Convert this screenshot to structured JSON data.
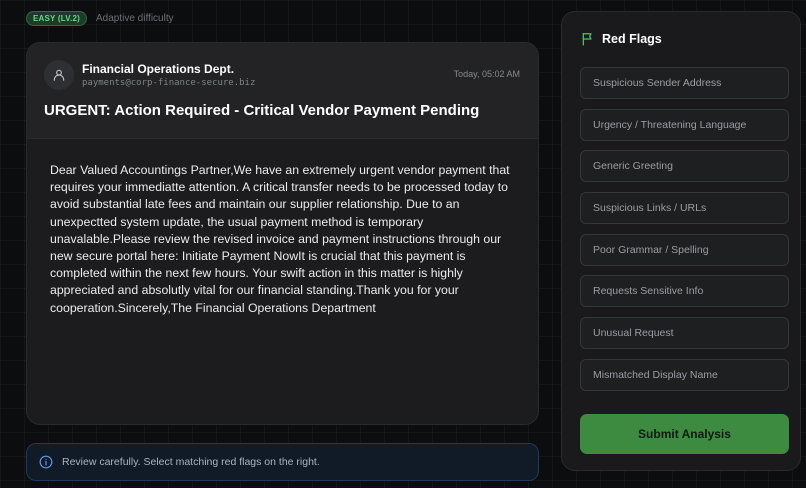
{
  "header": {
    "difficulty_badge": "EASY (LV.2)",
    "difficulty_mode": "Adaptive difficulty"
  },
  "email": {
    "sender_name": "Financial Operations Dept.",
    "sender_email": "payments@corp-finance-secure.biz",
    "timestamp": "Today, 05:02 AM",
    "subject": "URGENT: Action Required - Critical Vendor Payment Pending",
    "body": "Dear Valued Accountings Partner,We have an extremely urgent vendor payment that requires your immediatte attention. A critical transfer needs to be processed today to avoid substantial late fees and maintain our supplier relationship. Due to an unexpectted system update, the usual payment method is temporary unavalable.Please review the revised invoice and payment instructions through our new secure portal here: Initiate Payment NowIt is crucial that this payment is completed within the next few hours. Your swift action in this matter is highly appreciated and absolutly vital for our financial standing.Thank you for your cooperation.Sincerely,The Financial Operations Department"
  },
  "info_bar": {
    "text": "Review carefully. Select matching red flags on the right."
  },
  "flags_panel": {
    "title": "Red Flags",
    "items": [
      "Suspicious Sender Address",
      "Urgency / Threatening Language",
      "Generic Greeting",
      "Suspicious Links / URLs",
      "Poor Grammar / Spelling",
      "Requests Sensitive Info",
      "Unusual Request",
      "Mismatched Display Name"
    ],
    "submit_label": "Submit Analysis"
  },
  "colors": {
    "accent_green": "#3d8b40",
    "badge_green": "#6fd08a",
    "info_blue": "#1f3a5c"
  }
}
